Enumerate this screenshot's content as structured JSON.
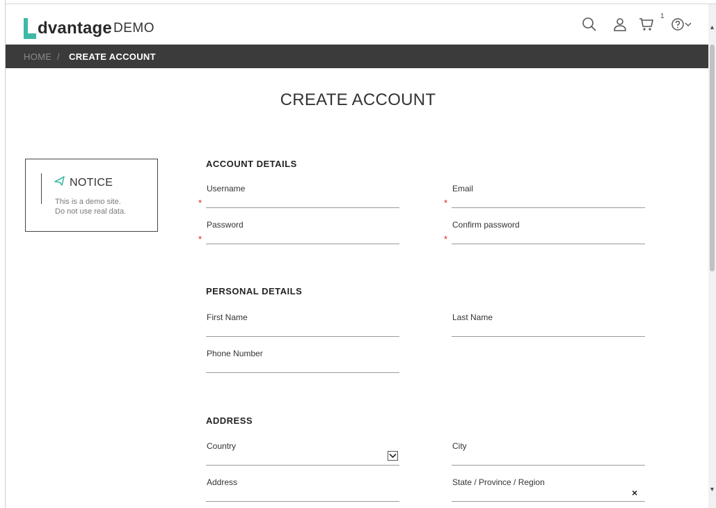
{
  "brand": {
    "name": "dvantage",
    "suffix": "DEMO",
    "accent_color": "#3fb8a5"
  },
  "header": {
    "icons": [
      "search-icon",
      "user-icon",
      "cart-icon",
      "help-icon",
      "chevron-down-icon"
    ],
    "cart_count": "1"
  },
  "breadcrumb": {
    "home": "HOME",
    "separator": "/",
    "current": "CREATE ACCOUNT"
  },
  "page_title": "CREATE ACCOUNT",
  "notice": {
    "title": "NOTICE",
    "line1": "This is a demo site.",
    "line2": "Do not use real data."
  },
  "sections": {
    "account": {
      "title": "ACCOUNT DETAILS",
      "username_label": "Username",
      "email_label": "Email",
      "password_label": "Password",
      "confirm_password_label": "Confirm password"
    },
    "personal": {
      "title": "PERSONAL DETAILS",
      "first_name_label": "First Name",
      "last_name_label": "Last Name",
      "phone_label": "Phone Number"
    },
    "address": {
      "title": "ADDRESS",
      "country_label": "Country",
      "city_label": "City",
      "address_label": "Address",
      "state_label": "State / Province / Region",
      "clear_glyph": "×"
    }
  },
  "required_marker": "*"
}
